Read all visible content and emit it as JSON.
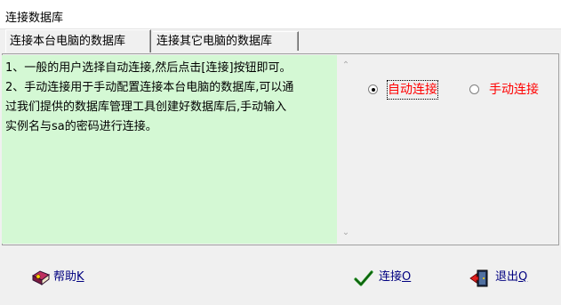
{
  "window": {
    "title": "连接数据库"
  },
  "tabs": [
    {
      "label": "连接本台电脑的数据库",
      "active": true
    },
    {
      "label": "连接其它电脑的数据库",
      "active": false
    }
  ],
  "memo": {
    "lines": [
      "1、一般的用户选择自动连接,然后点击[连接]按钮即可。",
      "2、手动连接用于手动配置连接本台电脑的数据库,可以通",
      "过我们提供的数据库管理工具创建好数据库后,手动输入",
      "实例名与sa的密码进行连接。"
    ],
    "background": "#d4f8d4"
  },
  "connection_mode": {
    "options": [
      {
        "label": "自动连接",
        "selected": true
      },
      {
        "label": "手动连接",
        "selected": false
      }
    ],
    "label_color": "#ff0000"
  },
  "buttons": {
    "help": {
      "label": "帮助",
      "hotkey": "K",
      "icon": "help-book-icon"
    },
    "connect": {
      "label": "连接",
      "hotkey": "O",
      "icon": "checkmark-icon"
    },
    "exit": {
      "label": "退出",
      "hotkey": "Q",
      "icon": "exit-door-icon"
    }
  }
}
